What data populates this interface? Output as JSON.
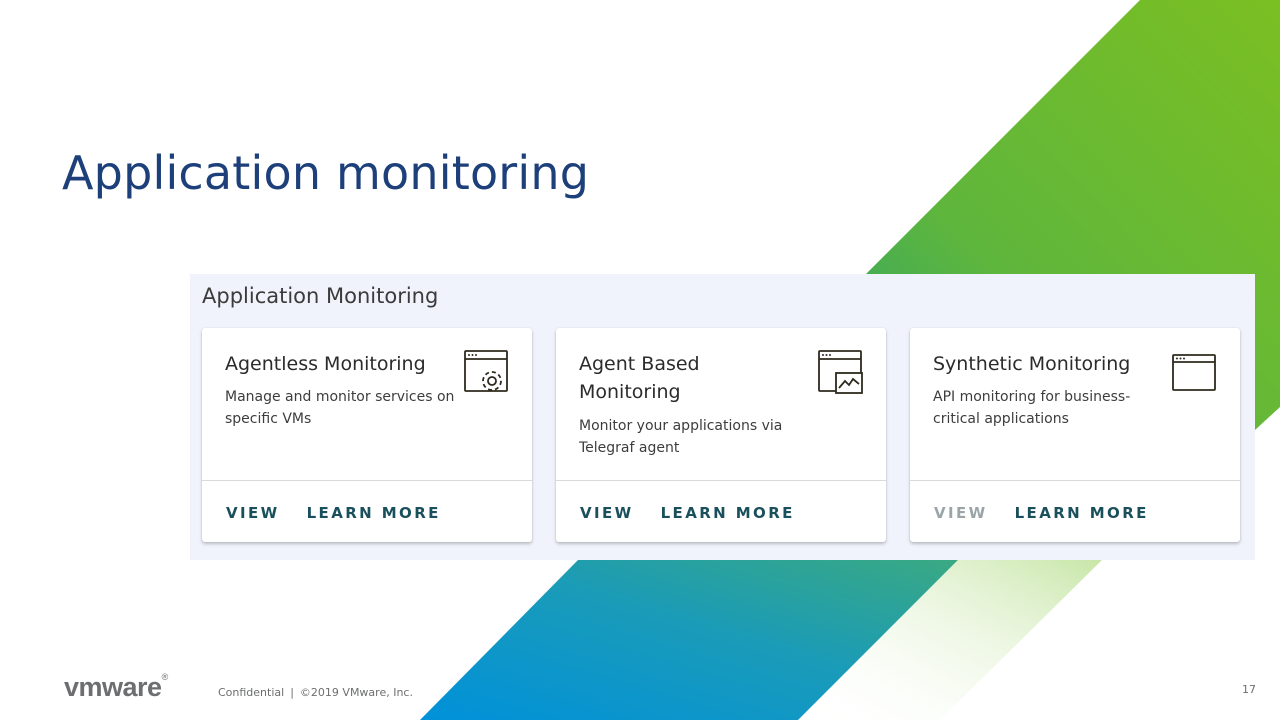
{
  "slide": {
    "title": "Application monitoring",
    "page_number": "17"
  },
  "panel": {
    "title": "Application Monitoring",
    "cards": [
      {
        "title": "Agentless Monitoring",
        "description": "Manage and monitor services on specific VMs",
        "icon": "window-gear-icon",
        "view_label": "VIEW",
        "view_enabled": true,
        "learn_more_label": "LEARN MORE"
      },
      {
        "title": "Agent Based Monitoring",
        "description": "Monitor your applications via Telegraf agent",
        "icon": "window-chart-icon",
        "view_label": "VIEW",
        "view_enabled": true,
        "learn_more_label": "LEARN MORE"
      },
      {
        "title": "Synthetic Monitoring",
        "description": "API monitoring for business-critical applications",
        "icon": "window-icon",
        "view_label": "VIEW",
        "view_enabled": false,
        "learn_more_label": "LEARN MORE"
      }
    ]
  },
  "footer": {
    "logo_text": "vmware",
    "confidential": "Confidential",
    "separator": "|",
    "copyright": "©2019 VMware, Inc."
  },
  "colors": {
    "title_blue": "#1d3f7a",
    "green": "#78be20",
    "blue": "#0091da",
    "action_teal": "#1a4f5c",
    "panel_bg": "#f0f3fb"
  }
}
